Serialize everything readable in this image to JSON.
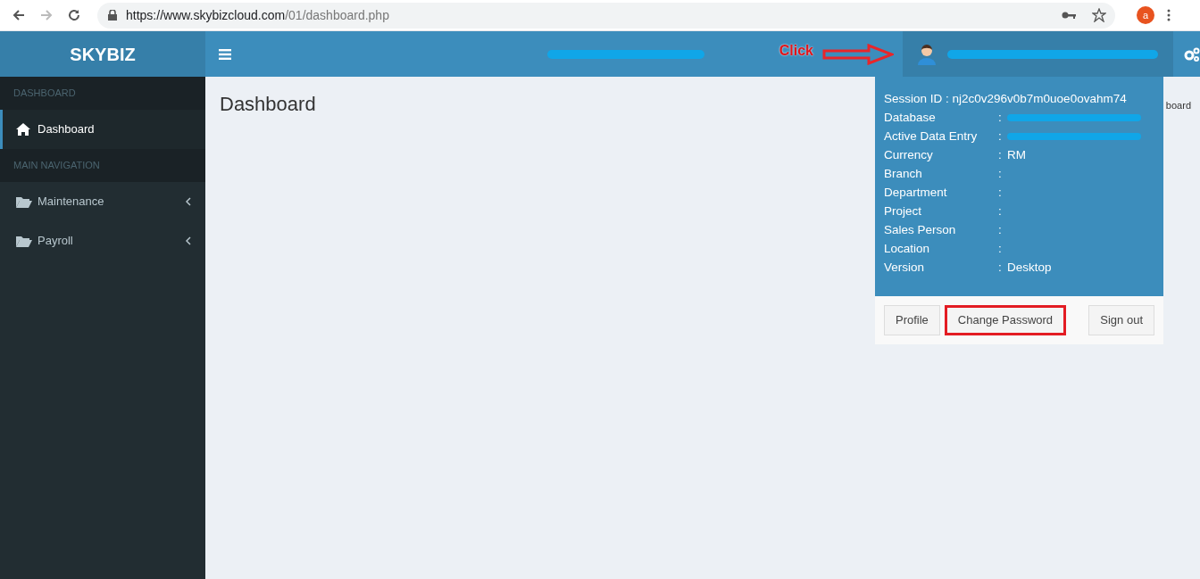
{
  "browser": {
    "url_host": "https://www.skybizcloud.com",
    "url_path": "/01/dashboard.php",
    "profile_initial": "a"
  },
  "header": {
    "logo": "SKYBIZ",
    "title_redacted": true,
    "annotation": "Click",
    "user_redacted": true
  },
  "sidebar": {
    "sections": [
      {
        "heading": "DASHBOARD",
        "items": [
          {
            "label": "Dashboard",
            "kind": "home",
            "selected": true,
            "expandable": false
          }
        ]
      },
      {
        "heading": "MAIN NAVIGATION",
        "items": [
          {
            "label": "Maintenance",
            "kind": "folder",
            "selected": false,
            "expandable": true
          },
          {
            "label": "Payroll",
            "kind": "folder",
            "selected": false,
            "expandable": true
          }
        ]
      }
    ]
  },
  "content": {
    "title": "Dashboard",
    "breadcrumb_fragment": "board"
  },
  "user_menu": {
    "session": "Session ID : nj2c0v296v0b7m0uoe0ovahm74",
    "rows": [
      {
        "label": "Database",
        "separator": ":",
        "redacted": true
      },
      {
        "label": "Active Data Entry",
        "separator": ":",
        "redacted": true
      },
      {
        "label": "Currency",
        "separator": ":",
        "value": "RM",
        "redacted": false
      },
      {
        "label": "Branch",
        "separator": ":",
        "redacted": false
      },
      {
        "label": "Department",
        "separator": ":",
        "redacted": false
      },
      {
        "label": "Project",
        "separator": ":",
        "redacted": false
      },
      {
        "label": "Sales Person",
        "separator": ":",
        "redacted": false
      },
      {
        "label": "Location",
        "separator": ":",
        "redacted": false
      },
      {
        "label": "Version",
        "separator": ":",
        "value": "Desktop",
        "redacted": false
      }
    ],
    "buttons": [
      {
        "label": "Profile",
        "highlighted": false
      },
      {
        "label": "Change Password",
        "highlighted": true
      },
      {
        "label": "Sign out",
        "highlighted": false
      }
    ]
  }
}
